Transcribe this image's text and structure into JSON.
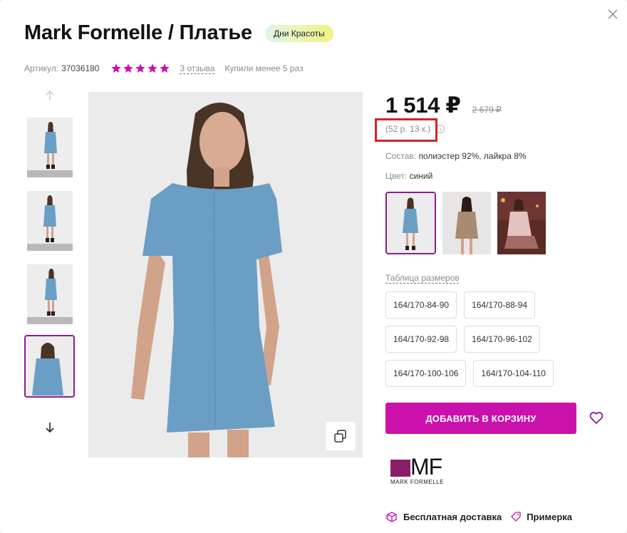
{
  "product": {
    "title": "Mark Formelle / Платье",
    "promo_badge": "Дни Красоты",
    "articul_label": "Артикул:",
    "articul_value": "37036180",
    "rating_stars": 5,
    "reviews_link": "3 отзыва",
    "bought_text": "Купили менее 5 раз"
  },
  "gallery": {
    "thumbnail_count": 4,
    "active_thumbnail": 4,
    "up_arrow_icon": "arrow-up-icon",
    "down_arrow_icon": "arrow-down-icon",
    "zoom_icon": "copy-zoom-icon"
  },
  "pricing": {
    "price": "1 514 ₽",
    "old_price": "2 679 ₽",
    "installment": "(52 р. 13 к.)",
    "info_icon": "info-icon"
  },
  "details": {
    "composition_label": "Состав:",
    "composition_value": "полиэстер 92%, лайкра 8%",
    "color_label": "Цвет:",
    "color_value": "синий"
  },
  "colors": [
    "синий",
    "бежевый",
    "розовый"
  ],
  "sizes": {
    "table_link": "Таблица размеров",
    "rows": [
      [
        "164/170-84-90",
        "164/170-88-94"
      ],
      [
        "164/170-92-98",
        "164/170-96-102"
      ],
      [
        "164/170-100-106",
        "164/170-104-110"
      ]
    ]
  },
  "actions": {
    "add_to_cart": "ДОБАВИТЬ В КОРЗИНУ",
    "favorite_icon": "heart-icon"
  },
  "brand": {
    "logo_letters": "MF",
    "logo_name": "MARK FORMELLE"
  },
  "bottom": {
    "free_delivery": "Бесплатная доставка",
    "fitting": "Примерка"
  },
  "colors_theme": {
    "accent": "#cb11ab",
    "active_border": "#8a1e8f",
    "star": "#cb11ab",
    "highlight_box": "#d32424"
  }
}
